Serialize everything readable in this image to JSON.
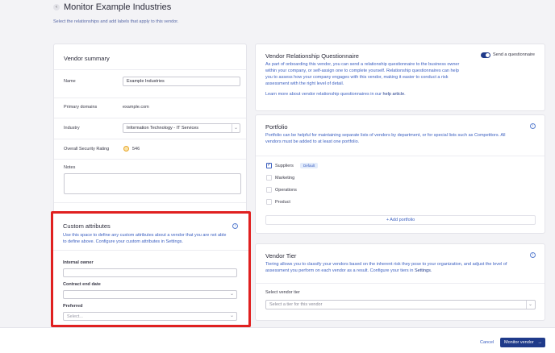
{
  "header": {
    "title": "Monitor Example Industries",
    "subtitle": "Select the relationships and add labels that apply to this vendor."
  },
  "vendor_summary": {
    "title": "Vendor summary",
    "name_label": "Name",
    "name_value": "Example Industries",
    "domains_label": "Primary domains",
    "domains_value": "example.com",
    "industry_label": "Industry",
    "industry_value": "Information Technology - IT Services",
    "rating_label": "Overall Security Rating",
    "rating_value": "546",
    "notes_label": "Notes"
  },
  "custom_attributes": {
    "title": "Custom attributes",
    "desc_line1": "Use this space to define any custom attributes about a vendor that you are not able",
    "desc_line2_prefix": "to define above. Configure your custom attributes in ",
    "desc_link": "Settings",
    "internal_owner_label": "Internal owner",
    "contract_end_label": "Contract end date",
    "preferred_label": "Preferred",
    "preferred_placeholder": "Select..."
  },
  "questionnaire": {
    "title": "Vendor Relationship Questionnaire",
    "toggle_label": "Send a questionnaire",
    "toggle_on": true,
    "desc_lines": [
      "As part of onboarding this vendor, you can send a relationship questionnaire to the business owner",
      "within your company, or self-assign one to complete yourself. Relationship questionnaires can help",
      "you to assess how your company engages with this vendor, making it easier to conduct a risk",
      "assessment with the right level of detail."
    ],
    "learn_prefix": "Learn more about vendor relationship questionnaires in our ",
    "learn_link": "help article",
    "learn_suffix": "."
  },
  "portfolio": {
    "title": "Portfolio",
    "desc_line1": "Portfolio can be helpful for maintaining separate lists of vendors by department, or for special lists such as Competitors. All",
    "desc_line2": "vendors must be added to at least one portfolio.",
    "items": [
      {
        "label": "Suppliers",
        "checked": true,
        "badge": "Default"
      },
      {
        "label": "Marketing",
        "checked": false
      },
      {
        "label": "Operations",
        "checked": false
      },
      {
        "label": "Product",
        "checked": false
      }
    ],
    "add_label": "+ Add portfolio"
  },
  "vendor_tier": {
    "title": "Vendor Tier",
    "desc_line1": "Tiering allows you to classify your vendors based on the inherent risk they pose to your organization, and adjust the level of",
    "desc_line2_prefix": "assessment you perform on each vendor as a result. Configure your tiers in ",
    "desc_link": "Settings",
    "select_label": "Select vendor tier",
    "select_placeholder": "Select a tier for this vendor"
  },
  "footer": {
    "cancel_label": "Cancel",
    "monitor_label": "Monitor vendor"
  },
  "colors": {
    "accent": "#3b5fc0",
    "highlight_border": "#e02020",
    "rating": "#e8a72b"
  }
}
